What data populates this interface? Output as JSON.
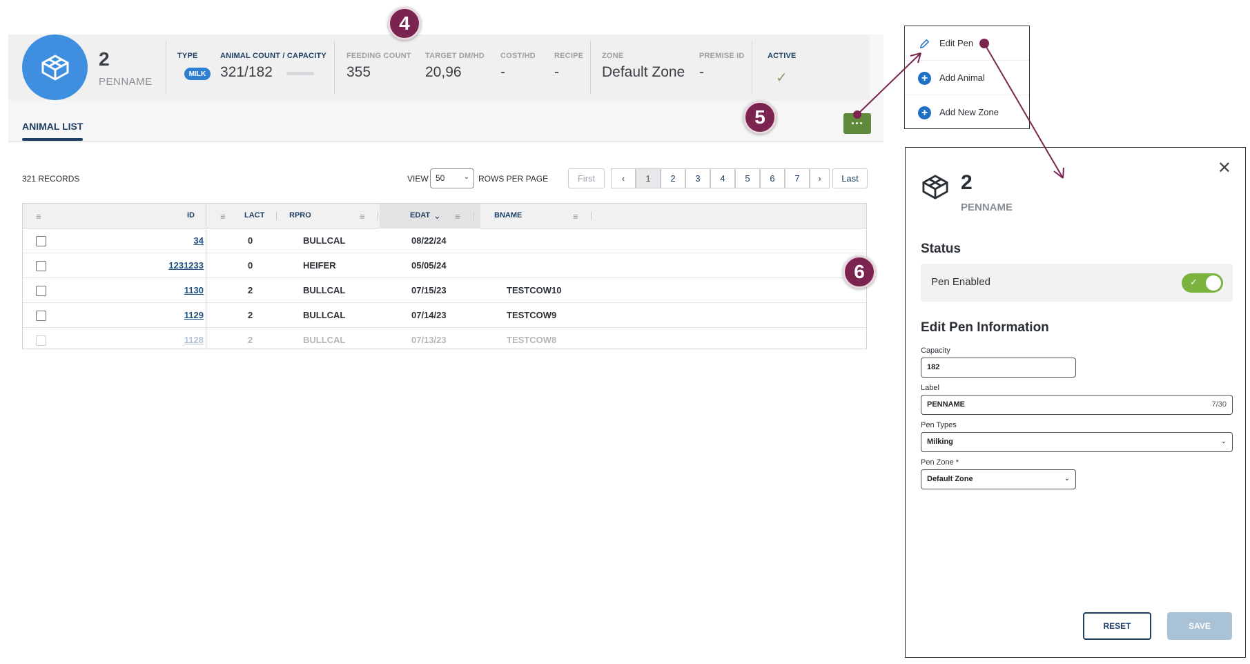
{
  "header": {
    "pen_number": "2",
    "pen_name": "PENNAME",
    "stats": {
      "type_label": "TYPE",
      "type_badge": "MILK",
      "animal_count_label": "ANIMAL COUNT / CAPACITY",
      "animal_count_value": "321/182",
      "feeding_count_label": "FEEDING COUNT",
      "feeding_count_value": "355",
      "target_dm_label": "TARGET DM/HD",
      "target_dm_value": "20,96",
      "cost_label": "COST/HD",
      "cost_value": "-",
      "recipe_label": "RECIPE",
      "recipe_value": "-",
      "zone_label": "ZONE",
      "zone_value": "Default Zone",
      "premise_label": "PREMISE ID",
      "premise_value": "-",
      "active_label": "ACTIVE",
      "active_value": "✓"
    },
    "tab_label": "ANIMAL LIST",
    "more_button_label": "···"
  },
  "callouts": {
    "c4": "4",
    "c5": "5",
    "c6": "6"
  },
  "toolbar": {
    "records": "321 RECORDS",
    "view_label": "VIEW",
    "view_value": "50",
    "rows_label": "ROWS PER PAGE",
    "pager": {
      "first": "First",
      "prev": "‹",
      "pages": [
        "1",
        "2",
        "3",
        "4",
        "5",
        "6",
        "7"
      ],
      "next": "›",
      "last": "Last"
    }
  },
  "table": {
    "columns": {
      "id": "ID",
      "lact": "LACT",
      "rpro": "RPRO",
      "edat": "EDAT",
      "bname": "BNAME"
    },
    "rows": [
      {
        "id": "34",
        "lact": "0",
        "rpro": "BULLCAL",
        "edat": "08/22/24",
        "bname": ""
      },
      {
        "id": "1231233",
        "lact": "0",
        "rpro": "HEIFER",
        "edat": "05/05/24",
        "bname": ""
      },
      {
        "id": "1130",
        "lact": "2",
        "rpro": "BULLCAL",
        "edat": "07/15/23",
        "bname": "TESTCOW10"
      },
      {
        "id": "1129",
        "lact": "2",
        "rpro": "BULLCAL",
        "edat": "07/14/23",
        "bname": "TESTCOW9"
      },
      {
        "id": "1128",
        "lact": "2",
        "rpro": "BULLCAL",
        "edat": "07/13/23",
        "bname": "TESTCOW8"
      }
    ]
  },
  "context_menu": {
    "items": [
      {
        "label": "Edit Pen",
        "icon": "pencil-icon"
      },
      {
        "label": "Add Animal",
        "icon": "plus-circle-icon"
      },
      {
        "label": "Add New Zone",
        "icon": "plus-circle-icon"
      }
    ]
  },
  "edit_panel": {
    "pen_number": "2",
    "pen_name": "PENNAME",
    "status_title": "Status",
    "pen_enabled_label": "Pen Enabled",
    "pen_enabled": true,
    "info_title": "Edit Pen Information",
    "capacity_label": "Capacity",
    "capacity_value": "182",
    "label_label": "Label",
    "label_value": "PENNAME",
    "label_counter": "7/30",
    "pen_types_label": "Pen Types",
    "pen_types_value": "Milking",
    "pen_zone_label": "Pen Zone *",
    "pen_zone_value": "Default Zone",
    "reset_label": "RESET",
    "save_label": "SAVE"
  },
  "colors": {
    "primary": "#1c3f63",
    "avatar_blue": "#3f8fe0",
    "callout": "#7b2450",
    "toggle_green": "#7ab33e",
    "more_button_green": "#5f8a3c"
  }
}
